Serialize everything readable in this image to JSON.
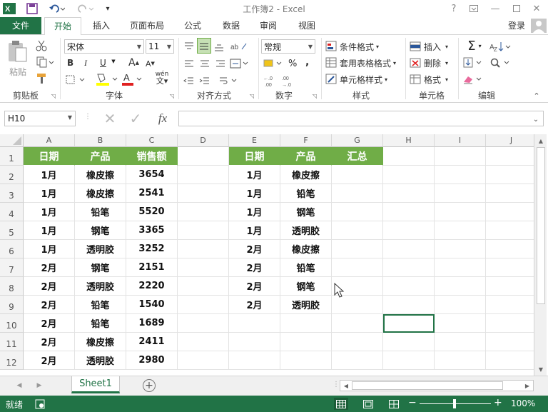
{
  "window": {
    "title": "工作簿2 - Excel",
    "help": "?",
    "login": "登录"
  },
  "tabs": [
    "文件",
    "开始",
    "插入",
    "页面布局",
    "公式",
    "数据",
    "审阅",
    "视图"
  ],
  "ribbon": {
    "clipboard": {
      "label": "剪贴板",
      "paste": "粘贴"
    },
    "font": {
      "label": "字体",
      "name": "宋体",
      "size": "11",
      "bold": "B",
      "italic": "I",
      "underline": "U",
      "grow": "A",
      "shrink": "A",
      "wen": "wén"
    },
    "alignment": {
      "label": "对齐方式"
    },
    "number": {
      "label": "数字",
      "format": "常规",
      "percent": "%",
      "comma": ","
    },
    "styles": {
      "label": "样式",
      "cond": "条件格式",
      "table": "套用表格格式",
      "cell": "单元格样式"
    },
    "cells": {
      "label": "单元格",
      "insert": "插入",
      "delete": "删除",
      "format": "格式"
    },
    "editing": {
      "label": "编辑"
    }
  },
  "formula": {
    "namebox": "H10",
    "fx": "fx",
    "value": ""
  },
  "columns": [
    "A",
    "B",
    "C",
    "D",
    "E",
    "F",
    "G",
    "H",
    "I",
    "J"
  ],
  "rows": [
    "1",
    "2",
    "3",
    "4",
    "5",
    "6",
    "7",
    "8",
    "9",
    "10",
    "11",
    "12"
  ],
  "table_left": {
    "headers": [
      "日期",
      "产品",
      "销售额"
    ],
    "rows": [
      [
        "1月",
        "橡皮擦",
        "3654"
      ],
      [
        "1月",
        "橡皮擦",
        "2541"
      ],
      [
        "1月",
        "铅笔",
        "5520"
      ],
      [
        "1月",
        "钢笔",
        "3365"
      ],
      [
        "1月",
        "透明胶",
        "3252"
      ],
      [
        "2月",
        "钢笔",
        "2151"
      ],
      [
        "2月",
        "透明胶",
        "2220"
      ],
      [
        "2月",
        "铅笔",
        "1540"
      ],
      [
        "2月",
        "铅笔",
        "1689"
      ],
      [
        "2月",
        "橡皮擦",
        "2411"
      ],
      [
        "2月",
        "透明胶",
        "2980"
      ]
    ]
  },
  "table_right": {
    "headers": [
      "日期",
      "产品",
      "汇总"
    ],
    "rows": [
      [
        "1月",
        "橡皮擦",
        ""
      ],
      [
        "1月",
        "铅笔",
        ""
      ],
      [
        "1月",
        "钢笔",
        ""
      ],
      [
        "1月",
        "透明胶",
        ""
      ],
      [
        "2月",
        "橡皮擦",
        ""
      ],
      [
        "2月",
        "铅笔",
        ""
      ],
      [
        "2月",
        "钢笔",
        ""
      ],
      [
        "2月",
        "透明胶",
        ""
      ]
    ]
  },
  "sheet_tab": "Sheet1",
  "status": {
    "ready": "就绪",
    "zoom": "100%"
  },
  "colors": {
    "excel_green": "#217346",
    "header_fill": "#70ad47"
  }
}
